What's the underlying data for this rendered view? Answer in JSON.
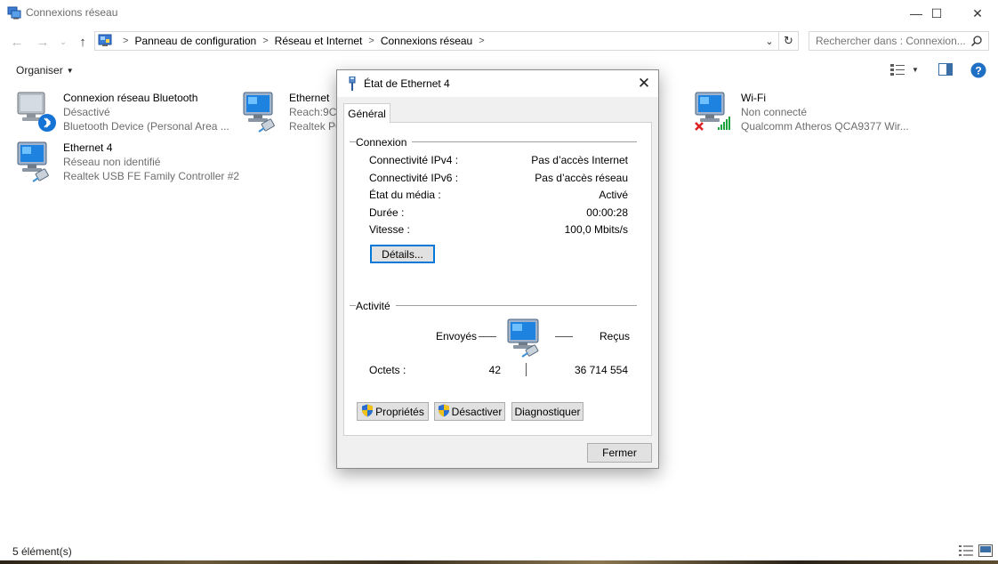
{
  "window": {
    "title": "Connexions réseau",
    "minimize_glyph": "—",
    "maximize_glyph": "☐",
    "close_glyph": "✕"
  },
  "nav": {
    "back_glyph": "←",
    "forward_glyph": "→",
    "recent_glyph": "⌄",
    "up_glyph": "↑",
    "breadcrumb": [
      "Panneau de configuration",
      "Réseau et Internet",
      "Connexions réseau"
    ],
    "refresh_glyph": "↻",
    "search_placeholder": "Rechercher dans : Connexion..."
  },
  "command_bar": {
    "organiser_label": "Organiser"
  },
  "connections": [
    {
      "name": "Connexion réseau Bluetooth",
      "status": "Désactivé",
      "device": "Bluetooth Device (Personal Area ...",
      "icon": "bluetooth-network-icon"
    },
    {
      "name": "Ethernet",
      "status": "Reach:9C:",
      "device": "Realtek PC",
      "icon": "ethernet-network-icon"
    },
    {
      "name": "Wi-Fi",
      "status": "Non connecté",
      "device": "Qualcomm Atheros QCA9377 Wir...",
      "icon": "wifi-network-icon"
    },
    {
      "name": "Ethernet 4",
      "status": "Réseau non identifié",
      "device": "Realtek USB FE Family Controller #2",
      "icon": "ethernet-network-icon"
    }
  ],
  "status_bar": {
    "count": "5 élément(s)"
  },
  "dialog": {
    "title": "État de Ethernet 4",
    "tab": "Général",
    "connection_group": "Connexion",
    "rows": [
      {
        "label": "Connectivité IPv4 :",
        "value": "Pas d’accès Internet"
      },
      {
        "label": "Connectivité IPv6 :",
        "value": "Pas d’accès réseau"
      },
      {
        "label": "État du média :",
        "value": "Activé"
      },
      {
        "label": "Durée :",
        "value": "00:00:28"
      },
      {
        "label": "Vitesse :",
        "value": "100,0 Mbits/s"
      }
    ],
    "details_button": "Détails...",
    "activity_group": "Activité",
    "sent_label": "Envoyés",
    "received_label": "Reçus",
    "bytes_label": "Octets :",
    "bytes_sent": "42",
    "bytes_received": "36 714 554",
    "properties_button": "Propriétés",
    "disable_button": "Désactiver",
    "diagnose_button": "Diagnostiquer",
    "close_button": "Fermer"
  }
}
